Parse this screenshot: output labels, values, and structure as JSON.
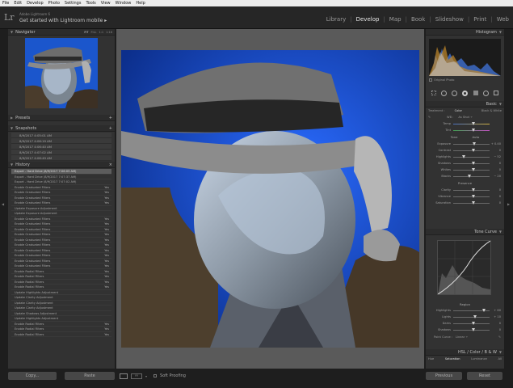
{
  "menubar": {
    "items": [
      "File",
      "Edit",
      "Develop",
      "Photo",
      "Settings",
      "Tools",
      "View",
      "Window",
      "Help"
    ]
  },
  "app": {
    "logo": "Lr",
    "subtitle": "Adobe Lightroom 6",
    "title": "Get started with Lightroom mobile",
    "title_arrow": "▸"
  },
  "modules": [
    "Library",
    "Develop",
    "Map",
    "Book",
    "Slideshow",
    "Print",
    "Web"
  ],
  "left": {
    "navigator": {
      "label": "Navigator",
      "zoom": [
        "FIT",
        "FILL",
        "1:1",
        "1:16"
      ]
    },
    "presets": {
      "label": "Presets"
    },
    "snapshots": {
      "label": "Snapshots",
      "items": [
        "8/9/2017 4:05:01 AM",
        "8/9/2017 4:06:19 AM",
        "8/9/2017 4:06:40 AM",
        "8/9/2017 4:07:02 AM",
        "8/9/2017 4:08:49 AM"
      ]
    },
    "history": {
      "label": "History",
      "items": [
        {
          "label": "Export - Hard Drive (8/9/2017 7:06:05 AM)",
          "value": ""
        },
        {
          "label": "Export - Hard Drive (8/9/2017 7:07:37 AM)",
          "value": ""
        },
        {
          "label": "Export - Hard Drive (8/9/2017 7:07:02 AM)",
          "value": ""
        },
        {
          "label": "Enable Graduated Filters",
          "value": "Yes"
        },
        {
          "label": "Enable Graduated Filters",
          "value": "Yes"
        },
        {
          "label": "Enable Graduated Filters",
          "value": "Yes"
        },
        {
          "label": "Enable Graduated Filters",
          "value": "Yes"
        },
        {
          "label": "Update Exposure Adjustment",
          "value": ""
        },
        {
          "label": "Update Exposure Adjustment",
          "value": ""
        },
        {
          "label": "Enable Graduated Filters",
          "value": "Yes"
        },
        {
          "label": "Enable Graduated Filters",
          "value": "Yes"
        },
        {
          "label": "Enable Graduated Filters",
          "value": "Yes"
        },
        {
          "label": "Enable Graduated Filters",
          "value": "Yes"
        },
        {
          "label": "Enable Graduated Filters",
          "value": "Yes"
        },
        {
          "label": "Enable Graduated Filters",
          "value": "Yes"
        },
        {
          "label": "Enable Graduated Filters",
          "value": "Yes"
        },
        {
          "label": "Enable Graduated Filters",
          "value": "Yes"
        },
        {
          "label": "Enable Graduated Filters",
          "value": "Yes"
        },
        {
          "label": "Enable Graduated Filters",
          "value": "Yes"
        },
        {
          "label": "Enable Radial Filters",
          "value": "Yes"
        },
        {
          "label": "Enable Radial Filters",
          "value": "Yes"
        },
        {
          "label": "Enable Radial Filters",
          "value": "Yes"
        },
        {
          "label": "Enable Radial Filters",
          "value": "Yes"
        },
        {
          "label": "Update Highlights Adjustment",
          "value": ""
        },
        {
          "label": "Update Clarity Adjustment",
          "value": ""
        },
        {
          "label": "Update Clarity Adjustment",
          "value": ""
        },
        {
          "label": "Update Clarity Adjustment",
          "value": ""
        },
        {
          "label": "Update Shadows Adjustment",
          "value": ""
        },
        {
          "label": "Update Highlights Adjustment",
          "value": ""
        },
        {
          "label": "Enable Radial Filters",
          "value": "Yes"
        },
        {
          "label": "Enable Radial Filters",
          "value": "Yes"
        },
        {
          "label": "Enable Radial Filters",
          "value": "Yes"
        }
      ]
    },
    "buttons": {
      "copy": "Copy...",
      "paste": "Paste"
    }
  },
  "toolbar": {
    "soft_proofing": "Soft Proofing"
  },
  "right": {
    "histogram": {
      "label": "Histogram",
      "original_photo": "Original Photo"
    },
    "basic": {
      "label": "Basic",
      "treatment_label": "Treatment :",
      "color": "Color",
      "bw": "Black & White",
      "wb_label": "WB :",
      "wb_value": "As Shot ÷",
      "temp": "Temp",
      "tint": "Tint",
      "tone_label": "Tone",
      "auto": "Auto",
      "sliders": [
        {
          "label": "Exposure",
          "value": "+ 0.40",
          "pos": 0.54
        },
        {
          "label": "Contrast",
          "value": "0",
          "pos": 0.5
        },
        {
          "label": "Highlights",
          "value": "− 52",
          "pos": 0.24
        },
        {
          "label": "Shadows",
          "value": "0",
          "pos": 0.5
        },
        {
          "label": "Whites",
          "value": "0",
          "pos": 0.5
        },
        {
          "label": "Blacks",
          "value": "− 20",
          "pos": 0.4
        }
      ],
      "presence_label": "Presence",
      "presence": [
        {
          "label": "Clarity",
          "value": "0",
          "pos": 0.5
        },
        {
          "label": "Vibrance",
          "value": "0",
          "pos": 0.5
        },
        {
          "label": "Saturation",
          "value": "0",
          "pos": 0.5
        }
      ]
    },
    "tonecurve": {
      "label": "Tone Curve",
      "region": "Region",
      "sliders": [
        {
          "label": "Highlights",
          "value": "+ 60",
          "pos": 0.8
        },
        {
          "label": "Lights",
          "value": "+ 10",
          "pos": 0.55
        },
        {
          "label": "Darks",
          "value": "0",
          "pos": 0.5
        },
        {
          "label": "Shadows",
          "value": "0",
          "pos": 0.5
        }
      ],
      "point_curve_label": "Point Curve :",
      "point_curve_value": "Linear ÷"
    },
    "hsl": {
      "label": "HSL / Color / B & W",
      "tabs": [
        "Hue",
        "Saturation",
        "Luminance",
        "All"
      ]
    },
    "buttons": {
      "previous": "Previous",
      "reset": "Reset"
    }
  }
}
